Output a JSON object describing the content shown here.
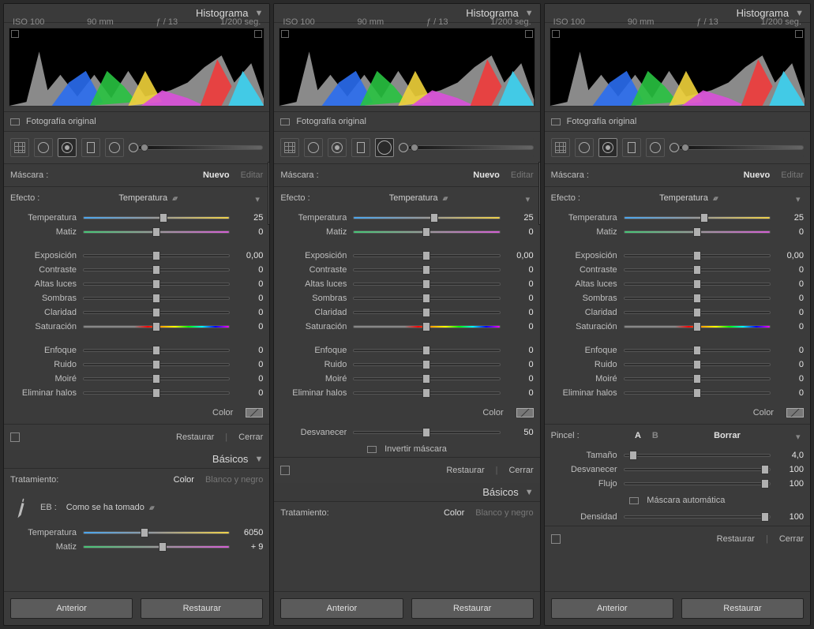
{
  "histogram": {
    "title": "Histograma",
    "iso": "ISO 100",
    "focal": "90 mm",
    "aperture": "ƒ / 13",
    "shutter": "1/200 seg.",
    "original": "Fotografía original"
  },
  "mask": {
    "label": "Máscara :",
    "new": "Nuevo",
    "edit": "Editar"
  },
  "effect": {
    "label": "Efecto :",
    "dropdown": "Temperatura"
  },
  "sliders_main": [
    {
      "label": "Temperatura",
      "value": "25",
      "track": "temp",
      "pos": 55
    },
    {
      "label": "Matiz",
      "value": "0",
      "track": "tint",
      "pos": 50
    }
  ],
  "sliders_tone": [
    {
      "label": "Exposición",
      "value": "0,00",
      "track": "",
      "pos": 50
    },
    {
      "label": "Contraste",
      "value": "0",
      "track": "",
      "pos": 50
    },
    {
      "label": "Altas luces",
      "value": "0",
      "track": "",
      "pos": 50
    },
    {
      "label": "Sombras",
      "value": "0",
      "track": "",
      "pos": 50
    },
    {
      "label": "Claridad",
      "value": "0",
      "track": "",
      "pos": 50
    },
    {
      "label": "Saturación",
      "value": "0",
      "track": "sat",
      "pos": 50
    }
  ],
  "sliders_detail": [
    {
      "label": "Enfoque",
      "value": "0",
      "track": "",
      "pos": 50
    },
    {
      "label": "Ruido",
      "value": "0",
      "track": "",
      "pos": 50
    },
    {
      "label": "Moiré",
      "value": "0",
      "track": "",
      "pos": 50
    },
    {
      "label": "Eliminar halos",
      "value": "0",
      "track": "",
      "pos": 50
    }
  ],
  "color_label": "Color",
  "restore": "Restaurar",
  "close": "Cerrar",
  "desvanecer": {
    "label": "Desvanecer",
    "value": "50"
  },
  "invert": "Invertir máscara",
  "basics": {
    "title": "Básicos",
    "treatment": "Tratamiento:",
    "color": "Color",
    "bw": "Blanco y negro",
    "eb": "EB :",
    "as_shot": "Como se ha tomado",
    "temp": {
      "label": "Temperatura",
      "value": "6050"
    },
    "tint": {
      "label": "Matiz",
      "value": "+ 9"
    }
  },
  "brush": {
    "label": "Pincel :",
    "A": "A",
    "B": "B",
    "borrar": "Borrar",
    "sliders": [
      {
        "label": "Tamaño",
        "value": "4,0",
        "pos": 6
      },
      {
        "label": "Desvanecer",
        "value": "100",
        "pos": 97
      },
      {
        "label": "Flujo",
        "value": "100",
        "pos": 97
      }
    ],
    "auto_mask": "Máscara automática",
    "density": {
      "label": "Densidad",
      "value": "100",
      "pos": 97
    }
  },
  "footer": {
    "prev": "Anterior",
    "restore": "Restaurar"
  }
}
